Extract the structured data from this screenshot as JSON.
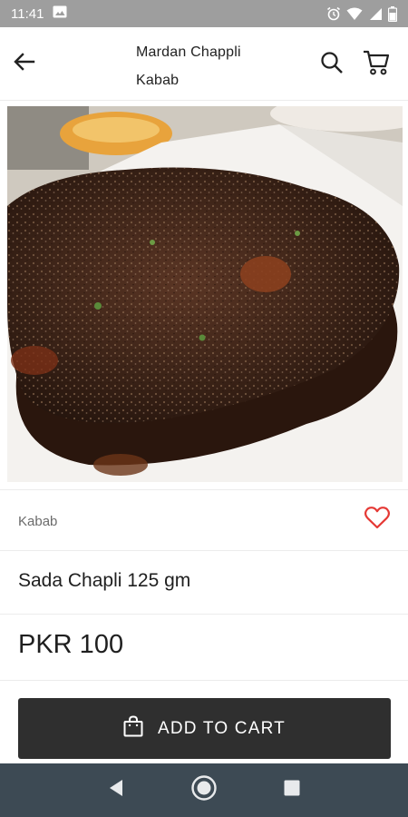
{
  "status_bar": {
    "time": "11:41",
    "icons": [
      "image-icon",
      "alarm-icon",
      "wifi-icon",
      "signal-icon",
      "battery-icon"
    ]
  },
  "app_bar": {
    "title": "Mardan Chappli Kabab",
    "icons": [
      "back-arrow-icon",
      "search-icon",
      "cart-icon"
    ]
  },
  "product": {
    "image_description_icon": "food-photo",
    "category": "Kabab",
    "name": "Sada Chapli 125 gm",
    "price": "PKR 100",
    "favorite_icon": "heart-outline-icon",
    "favorite_color": "#e53935"
  },
  "actions": {
    "add_to_cart_label": "ADD TO CART",
    "add_to_cart_icon": "shopping-bag-icon",
    "button_color": "#2f2f2f"
  },
  "nav_bar": {
    "icons": [
      "nav-back-icon",
      "nav-home-icon",
      "nav-recents-icon"
    ]
  }
}
